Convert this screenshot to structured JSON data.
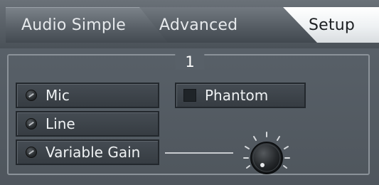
{
  "tabs": [
    {
      "label": "Audio Simple",
      "active": false
    },
    {
      "label": "Advanced",
      "active": false
    },
    {
      "label": "Setup",
      "active": true
    }
  ],
  "group": {
    "title": "1",
    "input_options": [
      {
        "label": "Mic",
        "icon": "led-icon"
      },
      {
        "label": "Line",
        "icon": "led-icon"
      },
      {
        "label": "Variable Gain",
        "icon": "led-icon"
      }
    ],
    "phantom": {
      "label": "Phantom",
      "icon": "checkbox-square"
    },
    "gain_knob": {
      "icon": "gain-knob"
    }
  },
  "colors": {
    "panel": "#586068",
    "active_tab": "#eef1f3",
    "button": "#3d434a",
    "text": "#eef1f3"
  }
}
